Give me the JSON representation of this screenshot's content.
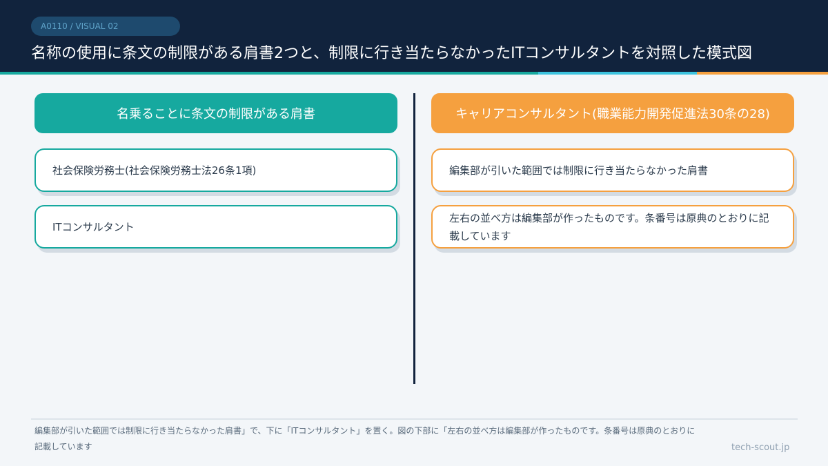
{
  "header": {
    "badge": "A0110 / VISUAL 02",
    "title": "名称の使用に条文の制限がある肩書2つと、制限に行き当たらなかったITコンサルタントを対照した模式図"
  },
  "left_column": {
    "heading": "名乗ることに条文の制限がある肩書",
    "items": [
      "社会保険労務士(社会保険労務士法26条1項)",
      "ITコンサルタント"
    ]
  },
  "right_column": {
    "heading": "キャリアコンサルタント(職業能力開発促進法30条の28)",
    "items": [
      "編集部が引いた範囲では制限に行き当たらなかった肩書",
      "左右の並べ方は編集部が作ったものです。条番号は原典のとおりに記載しています"
    ]
  },
  "footer": {
    "text": "編集部が引いた範囲では制限に行き当たらなかった肩書」で、下に「ITコンサルタント」を置く。図の下部に「左右の並べ方は編集部が作ったものです。条番号は原典のとおりに記載しています",
    "brand": "tech-scout.jp"
  },
  "colors": {
    "navy": "#11233d",
    "teal": "#16a99f",
    "orange": "#f5a03f",
    "sky": "#3cc3de"
  }
}
